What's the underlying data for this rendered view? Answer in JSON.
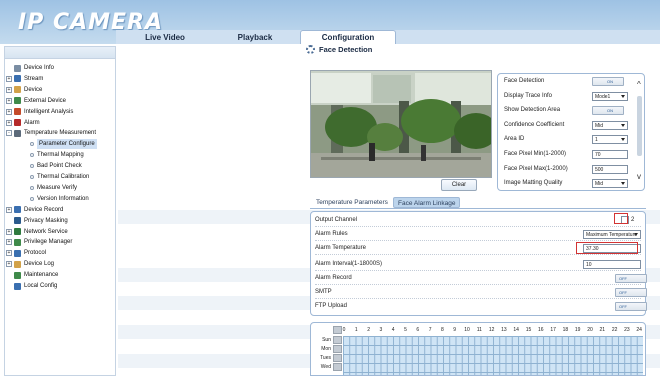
{
  "app": {
    "logo": "IP CAMERA",
    "logo_sub": ""
  },
  "tabs": [
    {
      "label": "Live Video"
    },
    {
      "label": "Playback"
    },
    {
      "label": "Configuration"
    }
  ],
  "page_title": "Face Detection",
  "sidebar": {
    "items": [
      {
        "label": "Device Info",
        "expand": "",
        "icon_color": "#7a8da3"
      },
      {
        "label": "Stream",
        "expand": "+",
        "icon_color": "#3a6fb0"
      },
      {
        "label": "Device",
        "expand": "+",
        "icon_color": "#d2a24a"
      },
      {
        "label": "External Device",
        "expand": "+",
        "icon_color": "#3f8a4a"
      },
      {
        "label": "Intelligent Analysis",
        "expand": "+",
        "icon_color": "#c44a2a"
      },
      {
        "label": "Alarm",
        "expand": "+",
        "icon_color": "#b52a2a"
      },
      {
        "label": "Temperature Measurement",
        "expand": "-",
        "icon_color": "#5c6a7a"
      },
      {
        "label": "Parameter Configure",
        "sub": true,
        "active": true
      },
      {
        "label": "Thermal Mapping",
        "sub": true
      },
      {
        "label": "Bad Point Check",
        "sub": true
      },
      {
        "label": "Thermal Calibration",
        "sub": true
      },
      {
        "label": "Measure Verify",
        "sub": true
      },
      {
        "label": "Version Information",
        "sub": true
      },
      {
        "label": "Device Record",
        "expand": "+",
        "icon_color": "#3a6fb0"
      },
      {
        "label": "Privacy Masking",
        "expand": "",
        "icon_color": "#2b5a8c"
      },
      {
        "label": "Network Service",
        "expand": "+",
        "icon_color": "#2f7a3f"
      },
      {
        "label": "Privilege Manager",
        "expand": "+",
        "icon_color": "#3f8a4a"
      },
      {
        "label": "Protocol",
        "expand": "+",
        "icon_color": "#3a6fb0"
      },
      {
        "label": "Device Log",
        "expand": "+",
        "icon_color": "#d2a24a"
      },
      {
        "label": "Maintenance",
        "expand": "",
        "icon_color": "#3f8a4a"
      },
      {
        "label": "Local Config",
        "expand": "",
        "icon_color": "#3a6fb0"
      }
    ]
  },
  "clear_label": "Clear",
  "face_settings": [
    {
      "label": "Face Detection",
      "type": "toggle",
      "value": "ON"
    },
    {
      "label": "Display Trace Info",
      "type": "select",
      "value": "Mode1"
    },
    {
      "label": "Show Detection Area",
      "type": "toggle",
      "value": "ON"
    },
    {
      "label": "Confidence Coefficient",
      "type": "select",
      "value": "Mid"
    },
    {
      "label": "Area ID",
      "type": "select",
      "value": "1"
    },
    {
      "label": "Face Pixel Min(1-2000)",
      "type": "input",
      "value": "70"
    },
    {
      "label": "Face Pixel Max(1-2000)",
      "type": "input",
      "value": "500"
    },
    {
      "label": "Image Matting Quality",
      "type": "select",
      "value": "Mid"
    }
  ],
  "subtabs": [
    {
      "label": "Temperature Parameters"
    },
    {
      "label": "Face Alarm Linkage"
    }
  ],
  "linkage": {
    "output_channel": {
      "label": "Output Channel",
      "option": "2"
    },
    "alarm_rules": {
      "label": "Alarm Rules",
      "value": "Maximum Temperature"
    },
    "alarm_temperature": {
      "label": "Alarm Temperature",
      "value": "37.30"
    },
    "alarm_interval": {
      "label": "Alarm Interval(1-18000S)",
      "value": "10"
    },
    "alarm_record": {
      "label": "Alarm Record",
      "value": "OFF"
    },
    "smtp": {
      "label": "SMTP",
      "value": "OFF"
    },
    "ftp_upload": {
      "label": "FTP Upload",
      "value": "OFF"
    }
  },
  "schedule": {
    "hours": [
      "0",
      "1",
      "2",
      "3",
      "4",
      "5",
      "6",
      "7",
      "8",
      "9",
      "10",
      "11",
      "12",
      "13",
      "14",
      "15",
      "16",
      "17",
      "18",
      "19",
      "20",
      "21",
      "22",
      "23",
      "24"
    ],
    "days": [
      "Sun",
      "Mon",
      "Tues",
      "Wed"
    ]
  }
}
